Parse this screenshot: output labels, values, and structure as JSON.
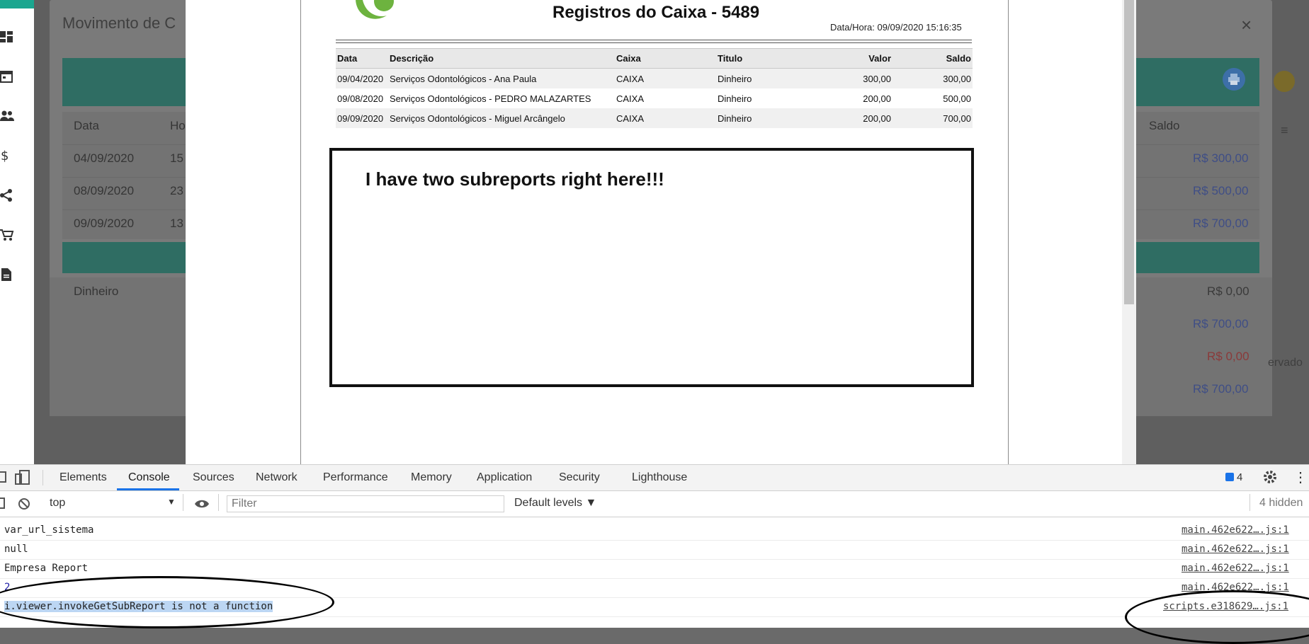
{
  "background_app": {
    "title": "Movimento de C",
    "close": "×",
    "table_header": {
      "col_data": "Data",
      "col_hora": "Ho",
      "col_saldo": "Saldo"
    },
    "rows": [
      {
        "data": "04/09/2020",
        "hora": "15",
        "saldo": "R$ 300,00"
      },
      {
        "data": "08/09/2020",
        "hora": "23",
        "saldo": "R$ 500,00"
      },
      {
        "data": "09/09/2020",
        "hora": "13",
        "saldo": "R$ 700,00"
      }
    ],
    "summary": [
      {
        "label": "Dinheiro",
        "value": "R$ 0,00"
      },
      {
        "label": "",
        "value": "R$ 700,00"
      },
      {
        "label": "",
        "value": "R$ 0,00"
      },
      {
        "label": "",
        "value": "R$ 700,00"
      }
    ],
    "reservado": "ervado"
  },
  "sidebar": {
    "icons": [
      "dashboard-icon",
      "calendar-icon",
      "people-icon",
      "dollar-icon",
      "share-icon",
      "cart-icon",
      "document-icon"
    ]
  },
  "report": {
    "title": "Registros do Caixa - 5489",
    "datetime": "Data/Hora: 09/09/2020 15:16:35",
    "columns": [
      "Data",
      "Descrição",
      "Caixa",
      "Titulo",
      "Valor",
      "Saldo"
    ],
    "rows": [
      [
        "09/04/2020",
        "Serviços Odontológicos - Ana Paula",
        "CAIXA",
        "Dinheiro",
        "300,00",
        "300,00"
      ],
      [
        "09/08/2020",
        "Serviços Odontológicos - PEDRO MALAZARTES",
        "CAIXA",
        "Dinheiro",
        "200,00",
        "500,00"
      ],
      [
        "09/09/2020",
        "Serviços Odontológicos - Miguel Arcângelo",
        "CAIXA",
        "Dinheiro",
        "200,00",
        "700,00"
      ]
    ],
    "subreport_note": "I have two subreports right here!!!"
  },
  "devtools": {
    "tabs": [
      "Elements",
      "Console",
      "Sources",
      "Network",
      "Performance",
      "Memory",
      "Application",
      "Security",
      "Lighthouse"
    ],
    "active_tab": "Console",
    "issues_count": "4",
    "context": "top",
    "filter_placeholder": "Filter",
    "levels": "Default levels ▼",
    "hidden": "4 hidden",
    "messages": [
      {
        "text": "var_url_sistema",
        "source": "main.462e622….js:1"
      },
      {
        "text": "null",
        "source": "main.462e622….js:1"
      },
      {
        "text": "Empresa Report",
        "source": "main.462e622….js:1"
      },
      {
        "text": "2",
        "source": "main.462e622….js:1"
      },
      {
        "text": "i.viewer.invokeGetSubReport is not a function",
        "source": "scripts.e318629….js:1"
      }
    ]
  },
  "colors": {
    "accent": "#1a73e8",
    "teal": "#1aa68f"
  }
}
